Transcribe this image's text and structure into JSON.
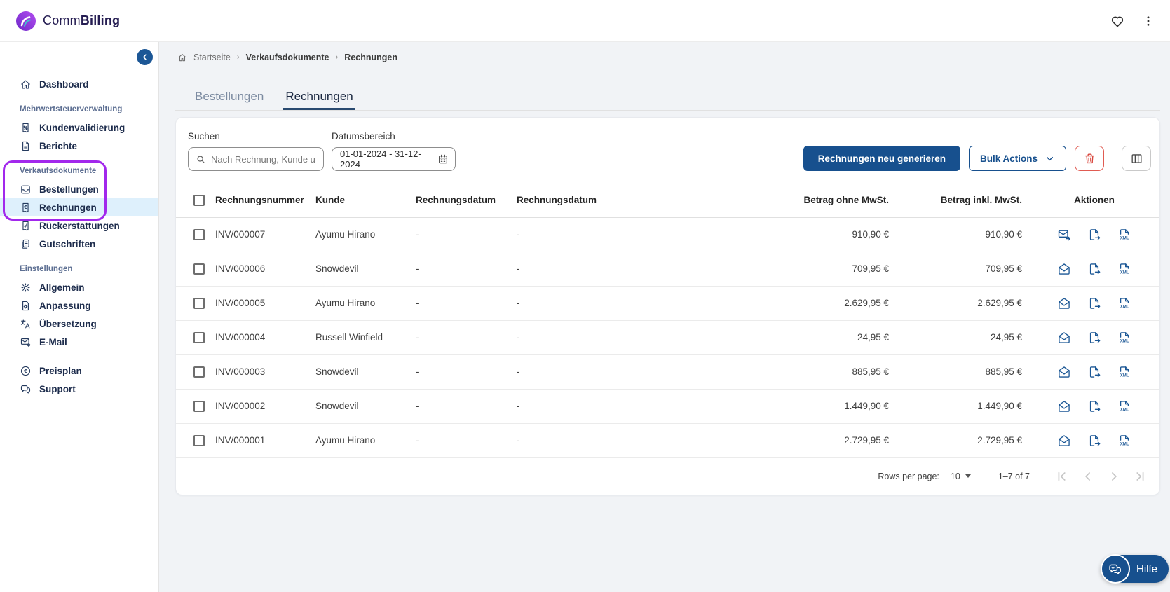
{
  "app": {
    "brand": {
      "name_regular": "Comm",
      "name_bold": "Billing"
    },
    "header_icons": [
      "favorite-heart-icon",
      "kebab-menu-icon"
    ]
  },
  "colors": {
    "primary_blue": "#17508E",
    "accent_purple": "#A228EC",
    "active_item_bg": "#DEF0FC",
    "danger_red": "#D8453B",
    "navy_text": "#1D2C4C",
    "content_bg": "#F1F3F6"
  },
  "sidebar": {
    "sections": [
      {
        "label": null,
        "items": [
          {
            "icon": "home-icon",
            "label": "Dashboard",
            "active": false
          }
        ]
      },
      {
        "label": "Mehrwertsteuerverwaltung",
        "items": [
          {
            "icon": "receipt-percent-icon",
            "label": "Kundenvalidierung",
            "active": false
          },
          {
            "icon": "document-icon",
            "label": "Berichte",
            "active": false
          }
        ]
      },
      {
        "label": "Verkaufsdokumente",
        "highlighted": true,
        "items": [
          {
            "icon": "inbox-icon",
            "label": "Bestellungen",
            "active": false
          },
          {
            "icon": "receipt-euro-icon",
            "label": "Rechnungen",
            "active": true
          }
        ]
      },
      {
        "label": null,
        "items": [
          {
            "icon": "receipt-return-icon",
            "label": "Rückerstattungen",
            "active": false
          },
          {
            "icon": "copy-document-icon",
            "label": "Gutschriften",
            "active": false
          }
        ]
      },
      {
        "label": "Einstellungen",
        "items": [
          {
            "icon": "gear-icon",
            "label": "Allgemein",
            "active": false
          },
          {
            "icon": "document-gear-icon",
            "label": "Anpassung",
            "active": false
          },
          {
            "icon": "translate-icon",
            "label": "Übersetzung",
            "active": false
          },
          {
            "icon": "mail-gear-icon",
            "label": "E-Mail",
            "active": false
          }
        ]
      },
      {
        "label": null,
        "gap_top": true,
        "items": [
          {
            "icon": "euro-circle-icon",
            "label": "Preisplan",
            "active": false
          },
          {
            "icon": "chat-icon",
            "label": "Support",
            "active": false
          }
        ]
      }
    ]
  },
  "breadcrumb": {
    "separator": "›",
    "items": [
      {
        "label": "Startseite",
        "strong": false
      },
      {
        "label": "Verkaufsdokumente",
        "strong": true
      },
      {
        "label": "Rechnungen",
        "strong": true
      }
    ]
  },
  "tabs": [
    {
      "label": "Bestellungen",
      "active": false
    },
    {
      "label": "Rechnungen",
      "active": true
    }
  ],
  "filters": {
    "search_label": "Suchen",
    "search_placeholder": "Nach Rechnung, Kunde u",
    "date_label": "Datumsbereich",
    "date_value": "01-01-2024 - 31-12-2024",
    "date_icon": "calendar-icon"
  },
  "toolbar": {
    "regenerate_label": "Rechnungen neu generieren",
    "bulk_actions_label": "Bulk Actions",
    "icons": [
      "chevron-down-icon",
      "trash-icon",
      "columns-icon"
    ]
  },
  "table": {
    "columns": [
      "Rechnungsnummer",
      "Kunde",
      "Rechnungsdatum",
      "Rechnungsdatum",
      "Betrag ohne MwSt.",
      "Betrag inkl. MwSt.",
      "Aktionen"
    ],
    "action_icons": [
      "mail-icon",
      "file-export-icon",
      "xml-file-icon"
    ],
    "rows": [
      {
        "number": "INV/000007",
        "customer": "Ayumu Hirano",
        "date1": "-",
        "date2": "-",
        "net": "910,90 €",
        "gross": "910,90 €",
        "mail_icon": "mail-send"
      },
      {
        "number": "INV/000006",
        "customer": "Snowdevil",
        "date1": "-",
        "date2": "-",
        "net": "709,95 €",
        "gross": "709,95 €",
        "mail_icon": "mail-open"
      },
      {
        "number": "INV/000005",
        "customer": "Ayumu Hirano",
        "date1": "-",
        "date2": "-",
        "net": "2.629,95 €",
        "gross": "2.629,95 €",
        "mail_icon": "mail-open"
      },
      {
        "number": "INV/000004",
        "customer": "Russell Winfield",
        "date1": "-",
        "date2": "-",
        "net": "24,95 €",
        "gross": "24,95 €",
        "mail_icon": "mail-open"
      },
      {
        "number": "INV/000003",
        "customer": "Snowdevil",
        "date1": "-",
        "date2": "-",
        "net": "885,95 €",
        "gross": "885,95 €",
        "mail_icon": "mail-open"
      },
      {
        "number": "INV/000002",
        "customer": "Snowdevil",
        "date1": "-",
        "date2": "-",
        "net": "1.449,90 €",
        "gross": "1.449,90 €",
        "mail_icon": "mail-open"
      },
      {
        "number": "INV/000001",
        "customer": "Ayumu Hirano",
        "date1": "-",
        "date2": "-",
        "net": "2.729,95 €",
        "gross": "2.729,95 €",
        "mail_icon": "mail-open"
      }
    ]
  },
  "pagination": {
    "rows_per_page_label": "Rows per page:",
    "rows_per_page_value": "10",
    "range_label": "1–7 of 7",
    "nav_icons": [
      "first-page-icon",
      "prev-page-icon",
      "next-page-icon",
      "last-page-icon"
    ]
  },
  "help": {
    "label": "Hilfe",
    "icon": "chat-bubbles-icon"
  }
}
